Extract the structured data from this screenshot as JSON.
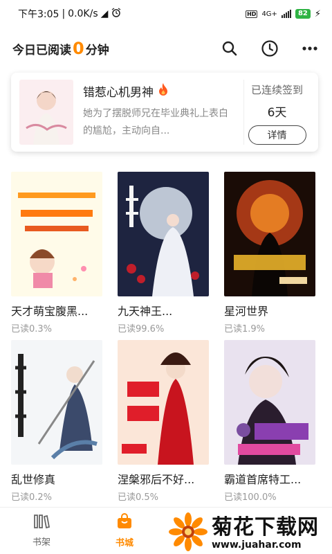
{
  "status_bar": {
    "time": "下午3:05",
    "speed": "0.0K/s",
    "network": "4G+",
    "hd": "HD",
    "battery": "82"
  },
  "header": {
    "reading_prefix": "今日已阅读",
    "reading_minutes": "0",
    "reading_suffix": "分钟",
    "icons": [
      "search-icon",
      "history-clock-icon",
      "more-dots-icon"
    ]
  },
  "recent_card": {
    "title": "错惹心机男神",
    "description": "她为了摆脱师兄在毕业典礼上表白的尴尬，主动向自...",
    "streak_label": "已连续签到",
    "streak_days": "6天",
    "detail_button": "详情"
  },
  "books": [
    {
      "title": "天才萌宝腹黑...",
      "progress": "已读0.3%"
    },
    {
      "title": "九天神王...",
      "progress": "已读99.6%"
    },
    {
      "title": "星河世界",
      "progress": "已读1.9%"
    },
    {
      "title": "乱世修真",
      "progress": "已读0.2%"
    },
    {
      "title": "涅槃邪后不好...",
      "progress": "已读0.5%"
    },
    {
      "title": "霸道首席特工...",
      "progress": "已读100.0%"
    }
  ],
  "tabbar": {
    "tabs": [
      {
        "label": "书架",
        "active": false
      },
      {
        "label": "书城",
        "active": true
      }
    ]
  },
  "watermark": {
    "main": "菊花下载网",
    "url": "www.juahar.com"
  },
  "colors": {
    "accent": "#ff8a00",
    "battery": "#2fb344"
  }
}
